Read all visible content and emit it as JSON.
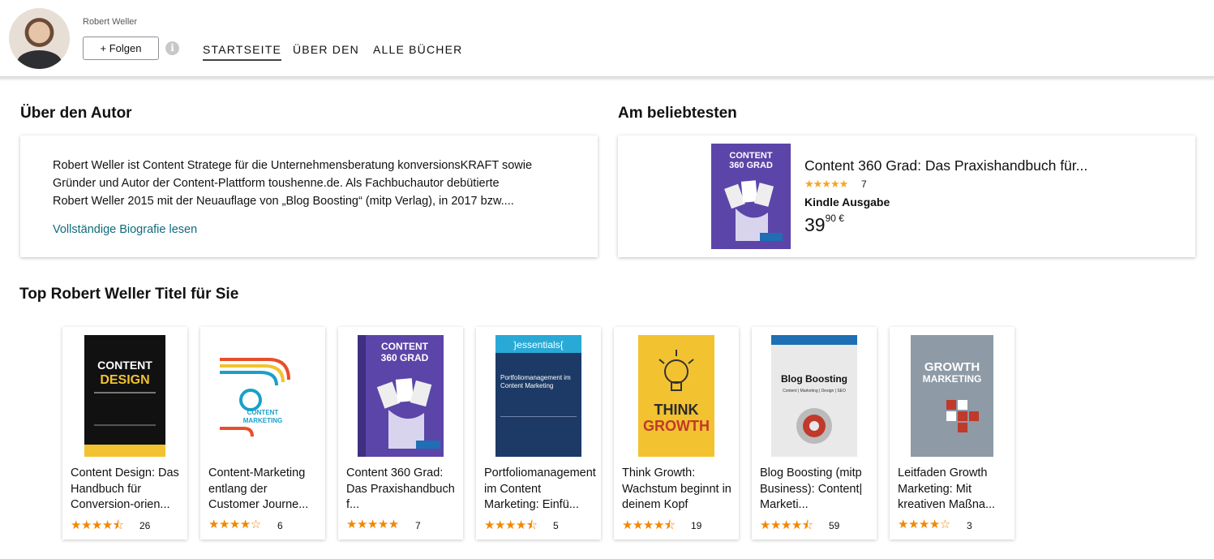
{
  "header": {
    "author_name": "Robert Weller",
    "follow_label": "+ Folgen",
    "info_glyph": "i",
    "nav": [
      {
        "label": "STARTSEITE",
        "active": true
      },
      {
        "label": "ÜBER DEN",
        "active": false
      },
      {
        "label": "ALLE BÜCHER",
        "active": false
      }
    ]
  },
  "about": {
    "heading": "Über den Autor",
    "bio_lines": [
      "Robert Weller ist Content Stratege für die Unternehmensberatung konversionsKRAFT sowie",
      "Gründer und Autor der Content-Plattform toushenne.de. Als Fachbuchautor debütierte",
      "Robert Weller 2015 mit der Neuauflage von „Blog Boosting“ (mitp Verlag), in 2017 bzw...."
    ],
    "link": "Vollständige Biografie lesen"
  },
  "popular": {
    "heading": "Am beliebtesten",
    "title": "Content 360 Grad: Das Praxishandbuch für...",
    "stars": "★★★★★",
    "review_count": "7",
    "format": "Kindle Ausgabe",
    "price_main": "39",
    "price_fraction": "90",
    "currency": "€",
    "cover_text": [
      "CONTENT",
      "360 GRAD"
    ]
  },
  "top_titles": {
    "heading": "Top Robert Weller Titel für Sie",
    "books": [
      {
        "title": "Content Design: Das Handbuch für Conversion-orien...",
        "stars": "★★★★⯪",
        "rating": 4.5,
        "count": "26",
        "cover": [
          "CONTENT",
          "DESIGN"
        ],
        "cover_color": "#111111"
      },
      {
        "title": "Content-Marketing entlang der Customer Journe...",
        "stars": "★★★★☆",
        "rating": 4,
        "count": "6",
        "cover": [
          "CONTENT",
          "MARKETING"
        ],
        "cover_color": "#ffffff"
      },
      {
        "title": "Content 360 Grad: Das Praxishandbuch f...",
        "stars": "★★★★★",
        "rating": 5,
        "count": "7",
        "cover": [
          "CONTENT",
          "360 GRAD"
        ],
        "cover_color": "#5b45a8"
      },
      {
        "title": "Portfoliomanagement im Content Marketing: Einfü...",
        "stars": "★★★★⯪",
        "rating": 4.5,
        "count": "5",
        "cover": [
          "}essentials{",
          "Portfoliomanagement im Content Marketing"
        ],
        "cover_color": "#1d3a66"
      },
      {
        "title": "Think Growth: Wachstum beginnt in deinem Kopf",
        "stars": "★★★★⯪",
        "rating": 4.5,
        "count": "19",
        "cover": [
          "THINK",
          "GROWTH"
        ],
        "cover_color": "#f2c230"
      },
      {
        "title": "Blog Boosting (mitp Business): Content| Marketi...",
        "stars": "★★★★⯪",
        "rating": 4.5,
        "count": "59",
        "cover": [
          "Blog Boosting",
          "Content | Marketing | Design | SEO"
        ],
        "cover_color": "#e9e9e9"
      },
      {
        "title": "Leitfaden Growth Marketing: Mit kreativen Maßna...",
        "stars": "★★★★☆",
        "rating": 4,
        "count": "3",
        "cover": [
          "GROWTH",
          "MARKETING"
        ],
        "cover_color": "#8e9aa6"
      }
    ]
  },
  "colors": {
    "star": "#f08804",
    "link": "#0f6b7b",
    "price": "#111111"
  }
}
